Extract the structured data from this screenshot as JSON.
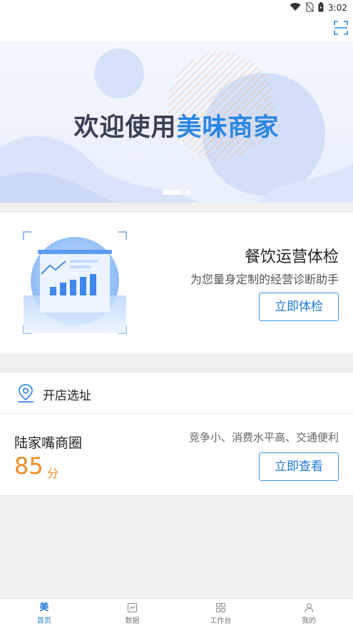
{
  "status_bar": {
    "time": "3:02"
  },
  "banner": {
    "title_prefix": "欢迎使用",
    "title_brand": "美味商家",
    "active_slide": 1,
    "slide_count": 2
  },
  "health_check": {
    "title": "餐饮运营体检",
    "subtitle": "为您量身定制的经营诊断助手",
    "button": "立即体检"
  },
  "site_selection": {
    "title": "开店选址",
    "area_name": "陆家嘴商圈",
    "score": "85",
    "score_unit": "分",
    "tags": "竞争小、消费水平高、交通便利",
    "button": "立即查看"
  },
  "tabbar": {
    "items": [
      {
        "label": "首页",
        "glyph": "美",
        "icon": "home-brand-icon",
        "active": true
      },
      {
        "label": "数据",
        "icon": "chart-icon",
        "active": false
      },
      {
        "label": "工作台",
        "icon": "grid-icon",
        "active": false
      },
      {
        "label": "我的",
        "icon": "person-icon",
        "active": false
      }
    ]
  },
  "colors": {
    "accent": "#1f78d6",
    "score": "#f08c23",
    "banner_text": "#3a3f55"
  }
}
